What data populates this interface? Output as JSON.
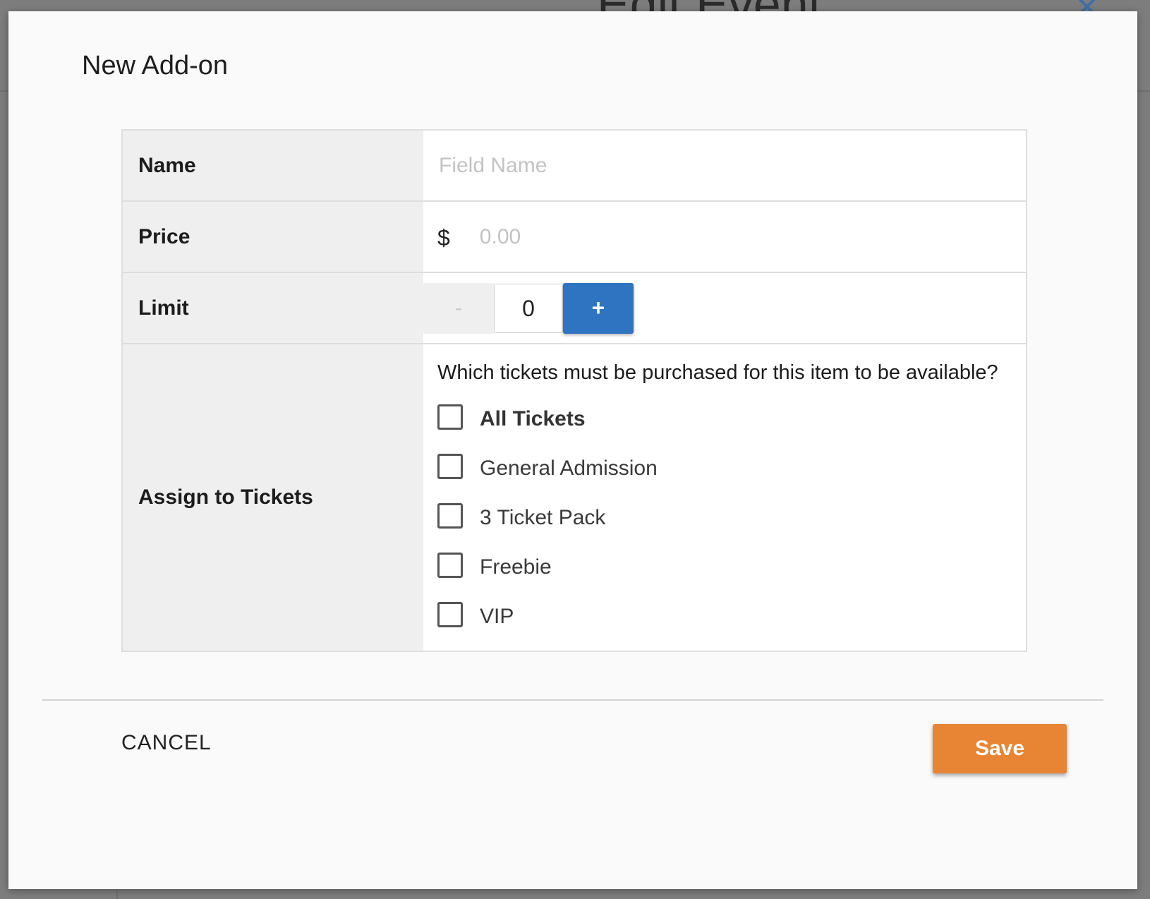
{
  "background": {
    "page_title": "Edit Event",
    "close_icon": "close-icon"
  },
  "modal": {
    "title": "New Add-on",
    "fields": {
      "name": {
        "label": "Name",
        "placeholder": "Field Name",
        "value": ""
      },
      "price": {
        "label": "Price",
        "currency_symbol": "$",
        "placeholder": "0.00",
        "value": ""
      },
      "limit": {
        "label": "Limit",
        "decrement_label": "-",
        "increment_label": "+",
        "value": "0"
      },
      "assign": {
        "label": "Assign to Tickets",
        "question": "Which tickets must be purchased for this item to be available?",
        "options": [
          {
            "label": "All Tickets",
            "checked": false
          },
          {
            "label": "General Admission",
            "checked": false
          },
          {
            "label": "3 Ticket Pack",
            "checked": false
          },
          {
            "label": "Freebie",
            "checked": false
          },
          {
            "label": "VIP",
            "checked": false
          }
        ]
      }
    },
    "footer": {
      "cancel_label": "CANCEL",
      "save_label": "Save"
    }
  },
  "colors": {
    "primary_blue": "#2f74c0",
    "save_orange": "#e88534"
  }
}
